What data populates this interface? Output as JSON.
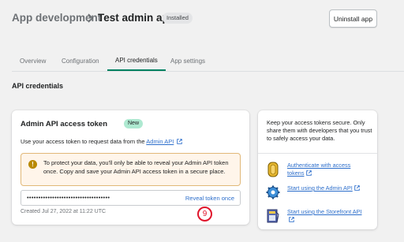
{
  "header": {
    "parent": "App development",
    "title": "Test admin app",
    "status_badge": "Installed",
    "uninstall_label": "Uninstall app"
  },
  "tabs": [
    {
      "label": "Overview"
    },
    {
      "label": "Configuration"
    },
    {
      "label": "API credentials",
      "selected": true
    },
    {
      "label": "App settings"
    }
  ],
  "section_title": "API credentials",
  "token_card": {
    "title": "Admin API access token",
    "badge": "New",
    "description_prefix": "Use your access token to request data from the",
    "description_link": "Admin API",
    "banner_text": "To protect your data, you'll only be able to reveal your Admin API token once. Copy and save your Admin API access token in a secure place.",
    "token_masked": "••••••••••••••••••••••••••••••••••••",
    "reveal_label": "Reveal token once",
    "created": "Created Jul 27, 2022 at 11:22 UTC"
  },
  "step_marker": "9",
  "side_card": {
    "text": "Keep your access tokens secure. Only share them with developers that you trust to safely access your data.",
    "links": [
      {
        "label": "Authenticate with access tokens",
        "icon": "coin-token-icon"
      },
      {
        "label": "Start using the Admin API",
        "icon": "gear-icon"
      },
      {
        "label": "Start using the Storefront API",
        "icon": "storefront-icon"
      }
    ]
  },
  "colors": {
    "accent": "#008060",
    "link": "#2c6ecb",
    "banner_bg": "#fff5ea",
    "marker": "#e0142b"
  }
}
